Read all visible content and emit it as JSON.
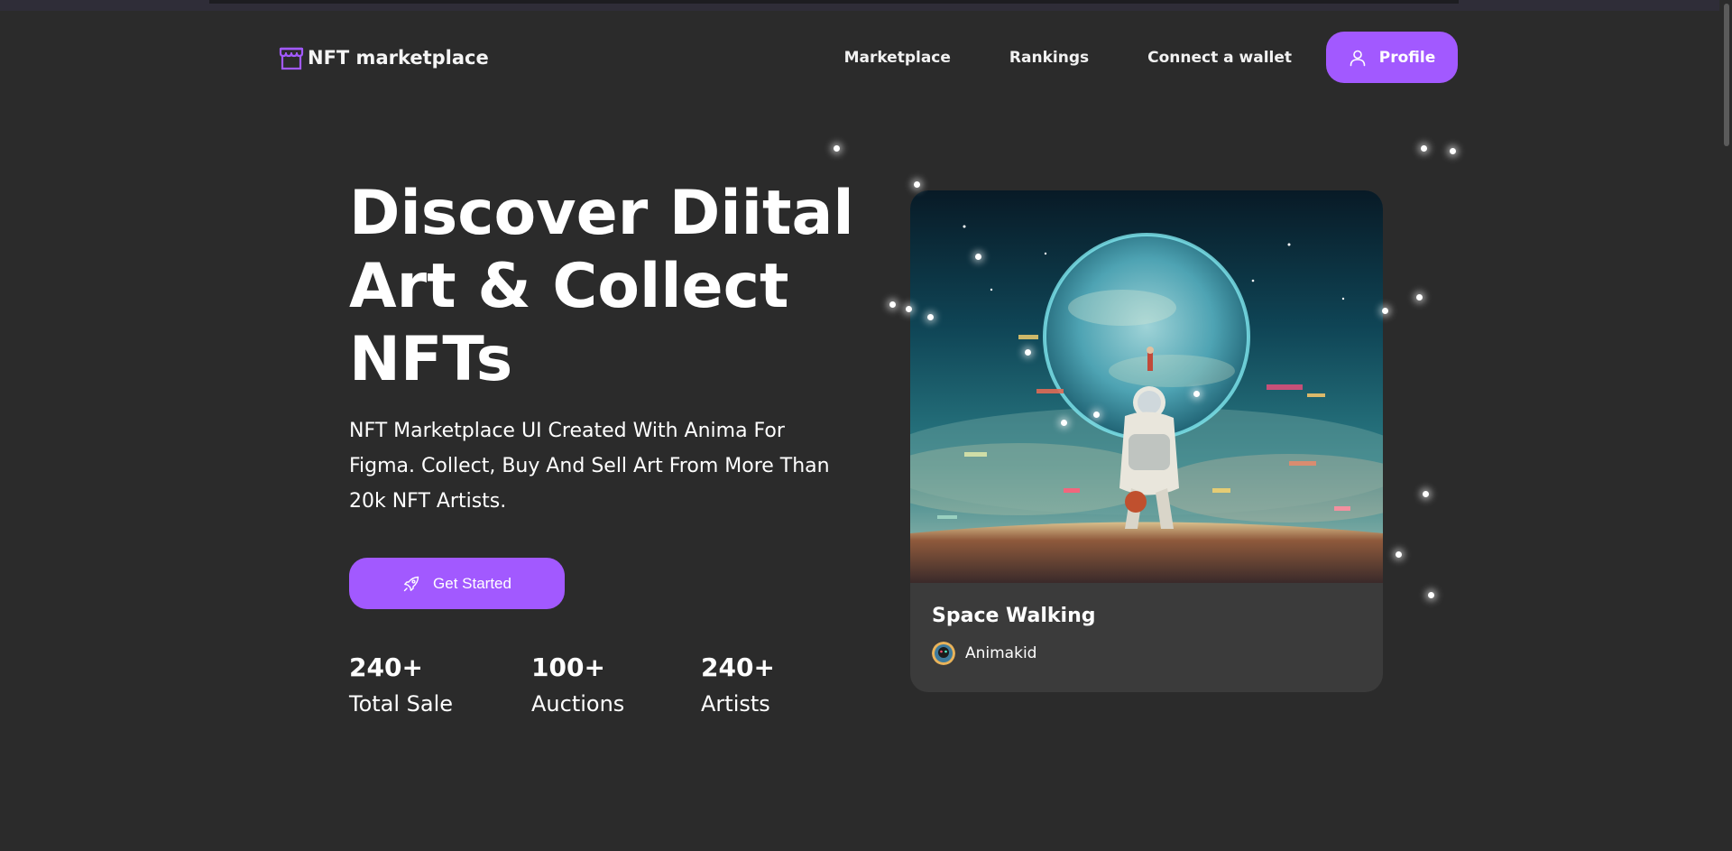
{
  "brand": {
    "name": "NFT marketplace",
    "accent_color": "#a259ff",
    "background_color": "#2b2b2b",
    "logo_icon": "storefront-icon"
  },
  "nav": {
    "links": [
      {
        "label": "Marketplace"
      },
      {
        "label": "Rankings"
      },
      {
        "label": "Connect a wallet"
      }
    ],
    "profile_button": {
      "label": "Profile",
      "icon": "user-icon"
    }
  },
  "hero": {
    "title": "Discover Diital Art & Collect NFTs",
    "subtitle": "NFT Marketplace UI Created With Anima For Figma. Collect, Buy And Sell Art From More Than 20k NFT Artists.",
    "cta": {
      "label": "Get Started",
      "icon": "rocket-icon"
    },
    "stats": [
      {
        "value": "240+",
        "label": "Total Sale"
      },
      {
        "value": "100+",
        "label": "Auctions"
      },
      {
        "value": "240+",
        "label": "Artists"
      }
    ]
  },
  "featured_card": {
    "title": "Space Walking",
    "artist": "Animakid",
    "artwork": "astronaut-planet-artwork",
    "card_color": "#3b3b3b"
  }
}
